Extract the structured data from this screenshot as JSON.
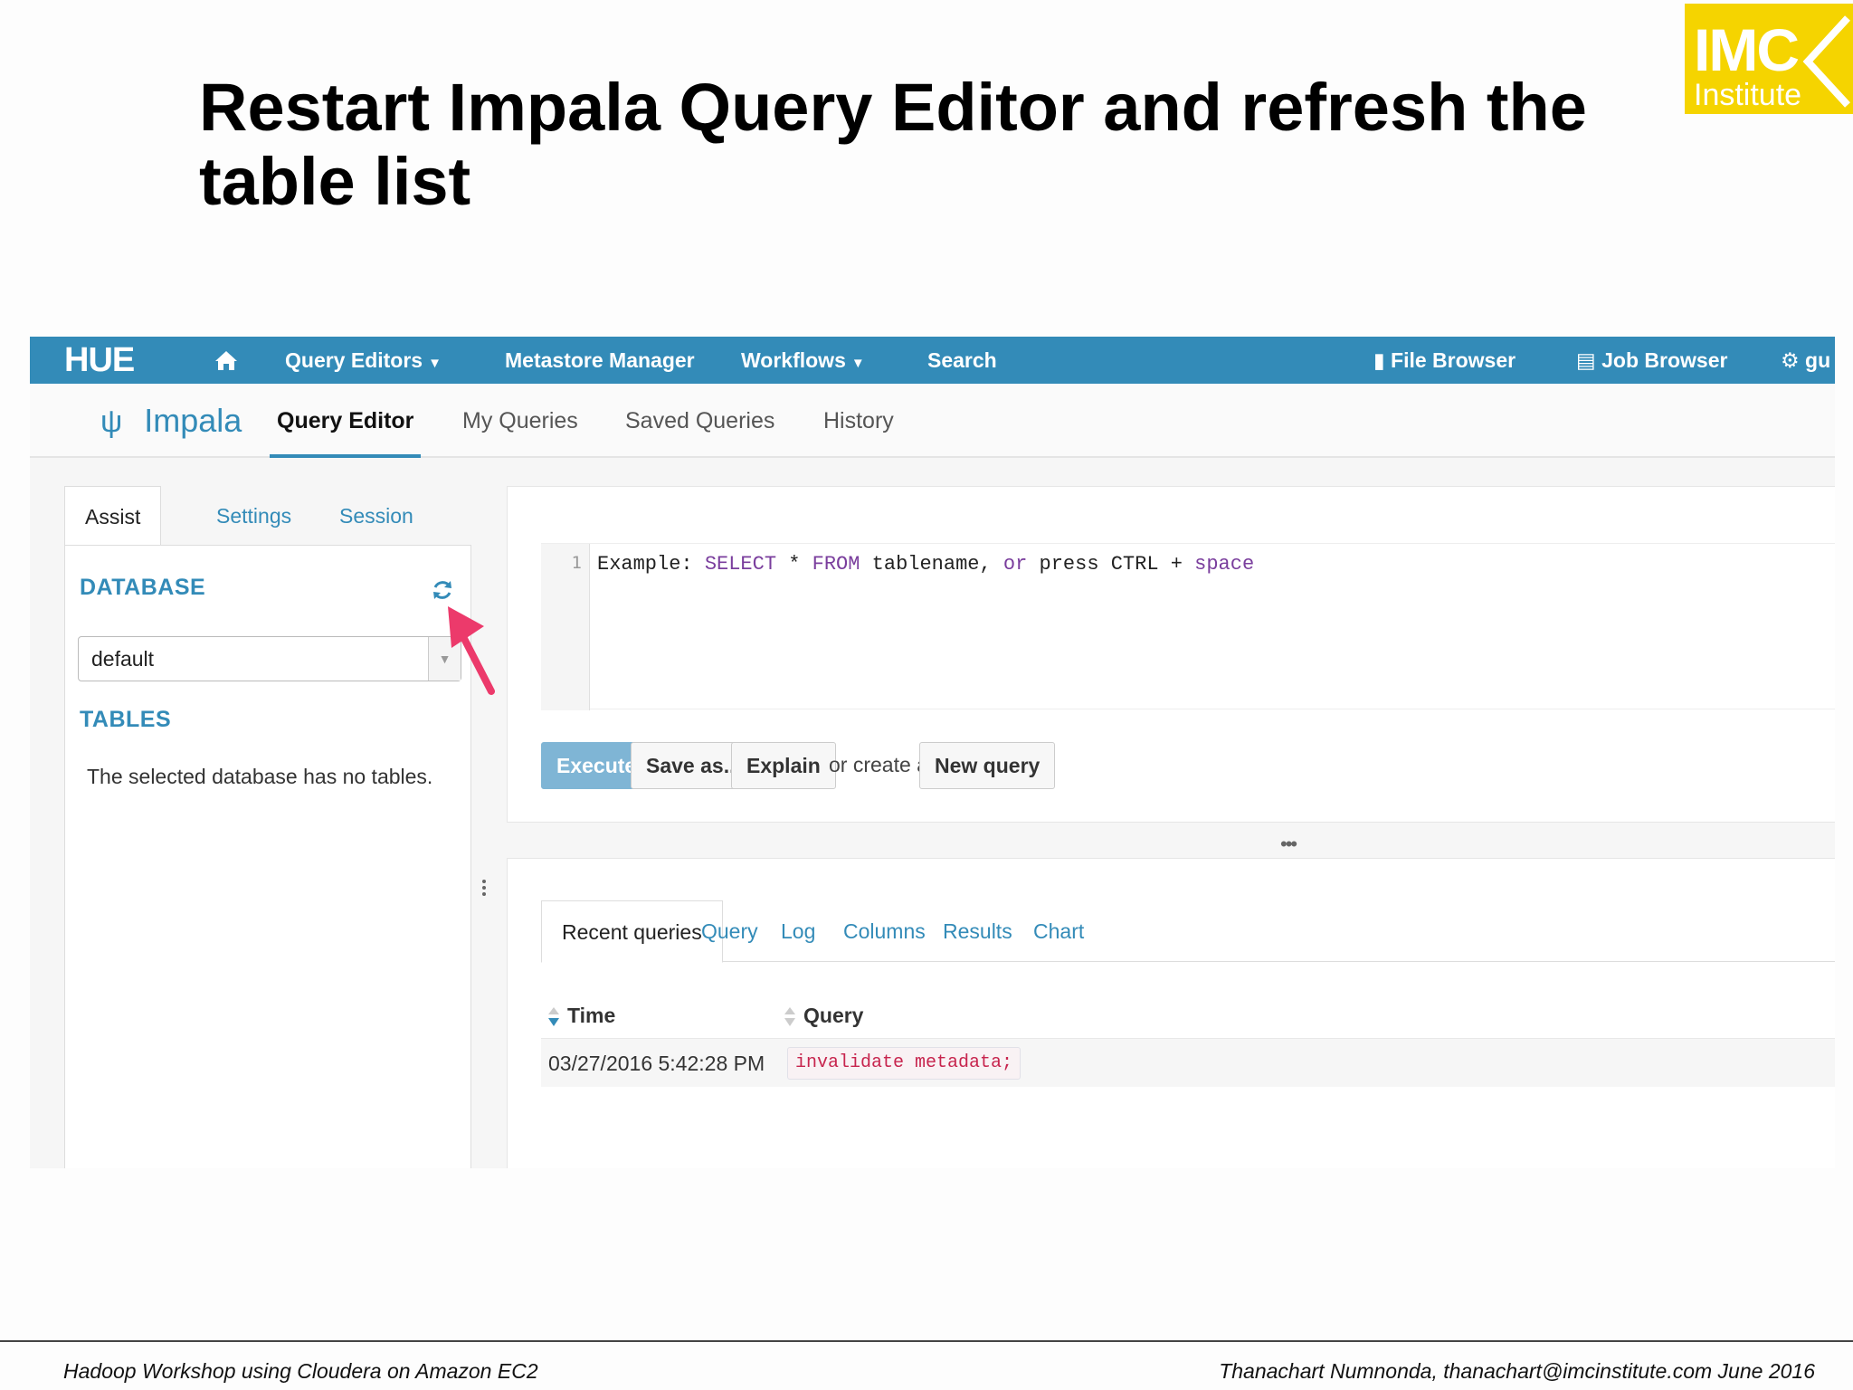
{
  "slide": {
    "title_line1": "Restart Impala Query Editor and refresh the",
    "title_line2": "table list",
    "logo_line1": "IMC",
    "logo_line2": "Institute",
    "footer_left": "Hadoop Workshop using Cloudera on Amazon EC2",
    "footer_right": "Thanachart Numnonda,  thanachart@imcinstitute.com  June 2016"
  },
  "topnav": {
    "logo": "HUE",
    "query_editors": "Query Editors",
    "metastore": "Metastore Manager",
    "workflows": "Workflows",
    "search": "Search",
    "file_browser": "File Browser",
    "job_browser": "Job Browser",
    "user": "gu"
  },
  "subnav": {
    "app": "Impala",
    "query_editor": "Query Editor",
    "my_queries": "My Queries",
    "saved_queries": "Saved Queries",
    "history": "History"
  },
  "assist": {
    "tabs": [
      "Assist",
      "Settings",
      "Session"
    ],
    "database_heading": "DATABASE",
    "database_value": "default",
    "tables_heading": "TABLES",
    "empty_message": "The selected database has no tables."
  },
  "editor": {
    "line_number": "1",
    "code": {
      "t1": "Example: ",
      "k1": "SELECT",
      "t2": " * ",
      "k2": "FROM",
      "t3": " tablename, ",
      "k3": "or",
      "t4": " press CTRL + ",
      "k4": "space"
    },
    "execute": "Execute",
    "save_as": "Save as...",
    "explain": "Explain",
    "or_create": "or create a",
    "new_query": "New query"
  },
  "results": {
    "tabs": [
      "Recent queries",
      "Query",
      "Log",
      "Columns",
      "Results",
      "Chart"
    ],
    "col_time": "Time",
    "col_query": "Query",
    "rows": [
      {
        "time": "03/27/2016 5:42:28 PM",
        "query": "invalidate metadata;"
      }
    ]
  },
  "colors": {
    "accent": "#338bb8",
    "annotation_arrow": "#ec3a6b",
    "logo_yellow": "#f5d400"
  }
}
